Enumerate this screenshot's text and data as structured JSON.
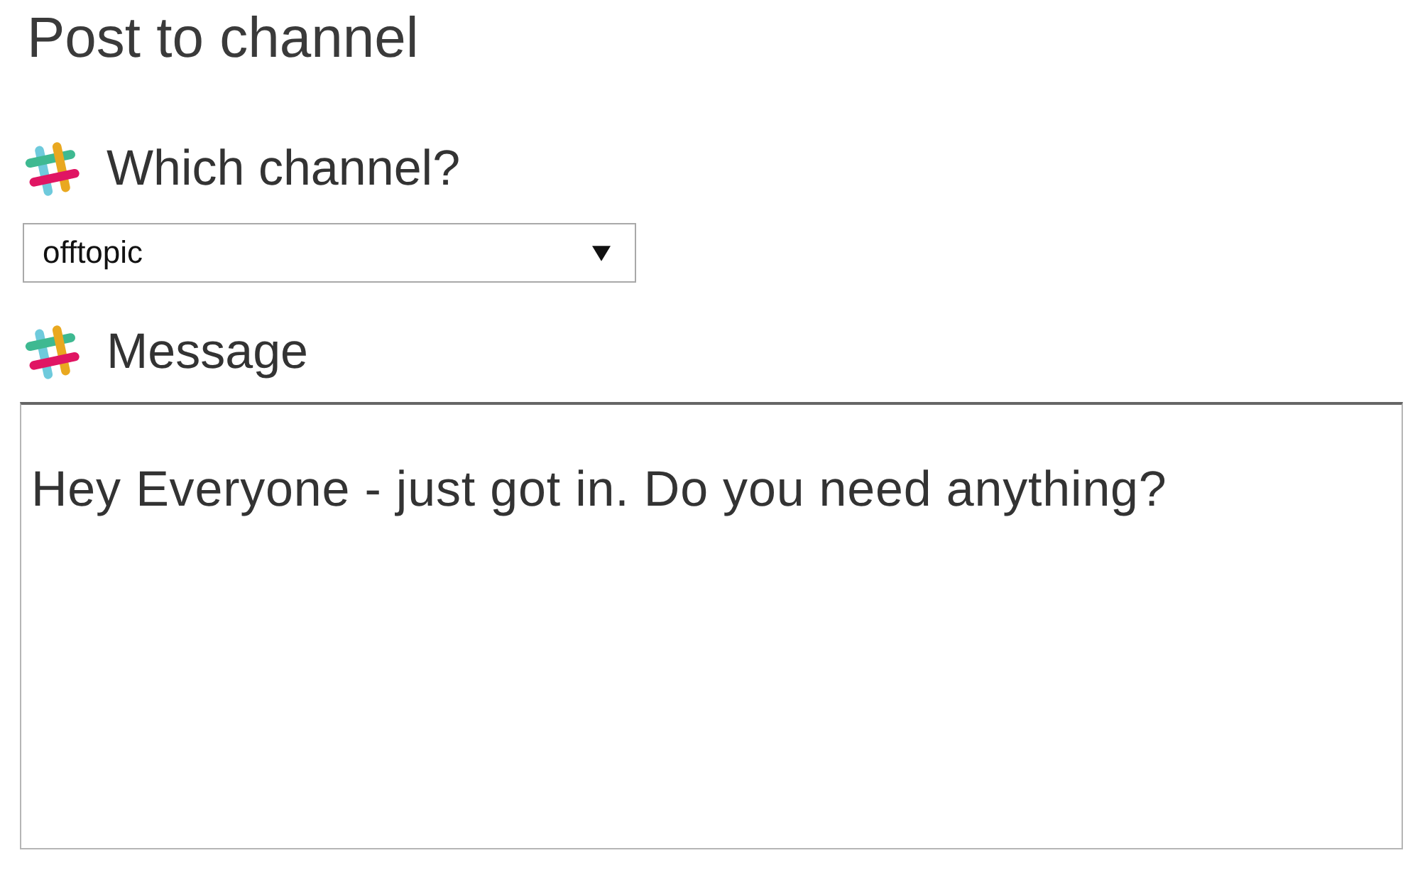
{
  "title": "Post to channel",
  "fields": [
    {
      "kind": "select",
      "label": "Which channel?",
      "value": "offtopic"
    },
    {
      "kind": "textarea",
      "label": "Message",
      "value": "Hey Everyone - just got in. Do you need anything?"
    }
  ]
}
